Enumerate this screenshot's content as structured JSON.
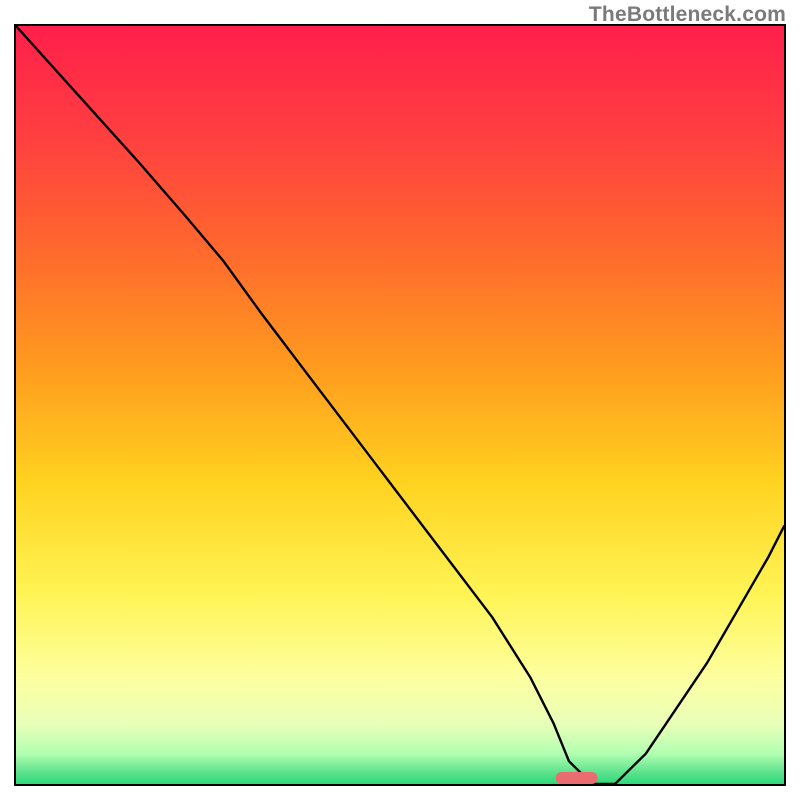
{
  "watermark": "TheBottleneck.com",
  "chart_data": {
    "type": "line",
    "title": "",
    "xlabel": "",
    "ylabel": "",
    "xlim": [
      0,
      100
    ],
    "ylim": [
      0,
      100
    ],
    "grid": false,
    "legend": false,
    "annotations": [
      {
        "name": "optimum-marker",
        "x": 73,
        "y": 0,
        "color": "#e86c70"
      }
    ],
    "background_gradient": {
      "stops": [
        {
          "offset": 0.0,
          "color": "#ff1f4b"
        },
        {
          "offset": 0.15,
          "color": "#ff4040"
        },
        {
          "offset": 0.3,
          "color": "#ff6a2d"
        },
        {
          "offset": 0.45,
          "color": "#ff9b1f"
        },
        {
          "offset": 0.6,
          "color": "#ffd21f"
        },
        {
          "offset": 0.75,
          "color": "#fff455"
        },
        {
          "offset": 0.86,
          "color": "#fdffa0"
        },
        {
          "offset": 0.92,
          "color": "#e9ffb8"
        },
        {
          "offset": 0.96,
          "color": "#b2ffb2"
        },
        {
          "offset": 0.985,
          "color": "#5ce28c"
        },
        {
          "offset": 1.0,
          "color": "#2bd97a"
        }
      ]
    },
    "series": [
      {
        "name": "bottleneck-curve",
        "color": "#000000",
        "x": [
          0,
          8,
          16,
          22,
          27,
          32,
          38,
          44,
          50,
          56,
          62,
          67,
          70,
          72,
          75,
          78,
          82,
          86,
          90,
          94,
          98,
          100
        ],
        "y": [
          100,
          91,
          82,
          75,
          69,
          62,
          54,
          46,
          38,
          30,
          22,
          14,
          8,
          3,
          0,
          0,
          4,
          10,
          16,
          23,
          30,
          34
        ]
      }
    ]
  }
}
